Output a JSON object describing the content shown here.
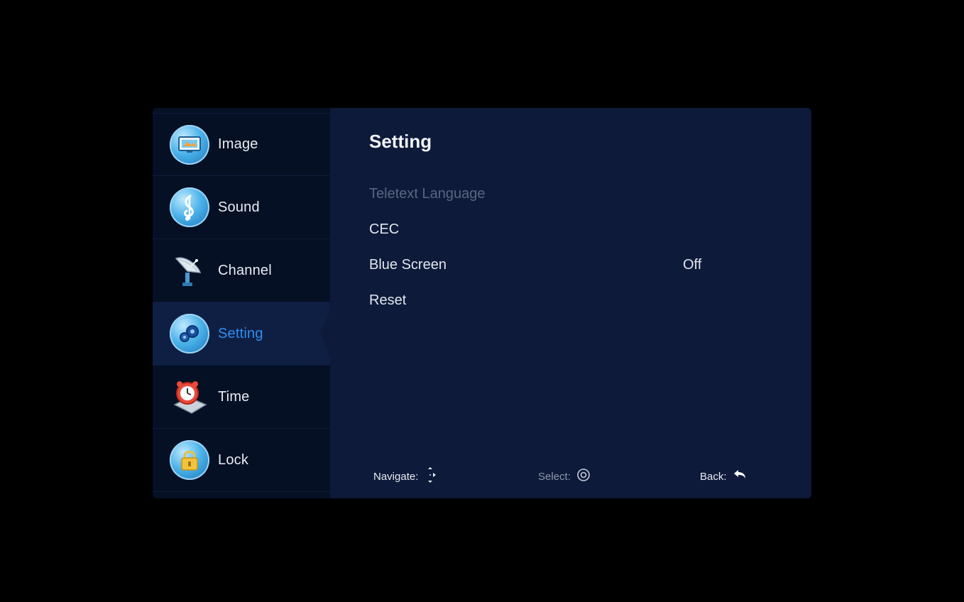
{
  "sidebar": {
    "items": [
      {
        "label": "Image",
        "icon": "image-icon"
      },
      {
        "label": "Sound",
        "icon": "sound-icon"
      },
      {
        "label": "Channel",
        "icon": "channel-icon"
      },
      {
        "label": "Setting",
        "icon": "setting-icon",
        "active": true
      },
      {
        "label": "Time",
        "icon": "time-icon"
      },
      {
        "label": "Lock",
        "icon": "lock-icon"
      }
    ]
  },
  "main": {
    "title": "Setting",
    "rows": [
      {
        "label": "Teletext Language",
        "value": "",
        "disabled": true
      },
      {
        "label": "CEC",
        "value": ""
      },
      {
        "label": "Blue Screen",
        "value": "Off"
      },
      {
        "label": "Reset",
        "value": ""
      }
    ]
  },
  "footer": {
    "navigate_label": "Navigate:",
    "select_label": "Select:",
    "back_label": "Back:"
  },
  "colors": {
    "active_accent": "#2f8ef0",
    "panel_bg": "#0d1a3a",
    "sidebar_bg": "#051024"
  }
}
